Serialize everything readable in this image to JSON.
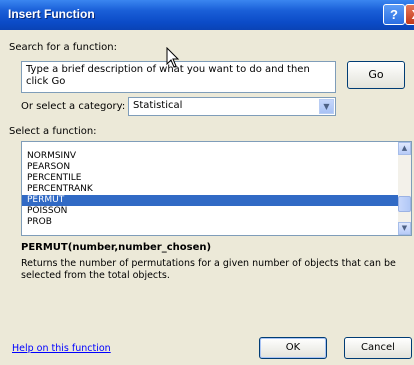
{
  "dialog": {
    "title": "Insert Function",
    "help_glyph": "?",
    "close_glyph": "X"
  },
  "search": {
    "label": "Search for a function:",
    "value": "Type a brief description of what you want to do and then click Go",
    "go_label": "Go"
  },
  "category": {
    "label": "Or select a category:",
    "selected": "Statistical"
  },
  "functions": {
    "label": "Select a function:",
    "items": [
      "NORMSINV",
      "PEARSON",
      "PERCENTILE",
      "PERCENTRANK",
      "PERMUT",
      "POISSON",
      "PROB"
    ],
    "selected": "PERMUT"
  },
  "details": {
    "signature": "PERMUT(number,number_chosen)",
    "description": "Returns the number of permutations for a given number of objects that can be selected from the total objects."
  },
  "footer": {
    "help_link": "Help on this function",
    "ok_label": "OK",
    "cancel_label": "Cancel"
  },
  "colors": {
    "title_bar": "#0b4bc7",
    "selection": "#316ac5",
    "dialog_bg": "#ece9d8",
    "link": "#0000ff"
  }
}
